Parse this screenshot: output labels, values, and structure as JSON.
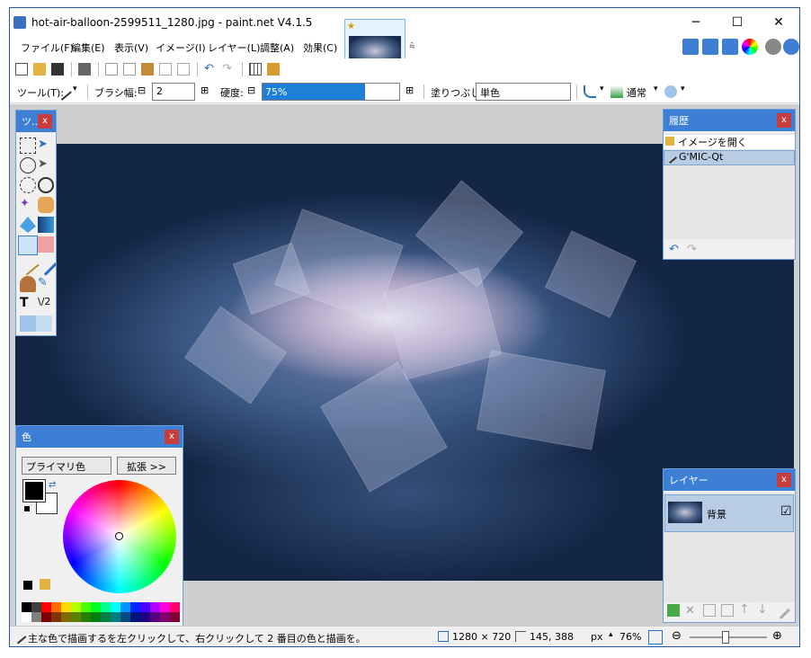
{
  "window": {
    "title": "hot-air-balloon-2599511_1280.jpg - paint.net V4.1.5",
    "minimize": "─",
    "maximize": "☐",
    "close": "✕"
  },
  "menu": [
    "ファイル(F)",
    "編集(E)",
    "表示(V)",
    "イメージ(I)",
    "レイヤー(L)",
    "調整(A)",
    "効果(C)"
  ],
  "doc_tab": {
    "star": "★"
  },
  "menu_overflow": "⩯",
  "toolbar2": {
    "tool_label": "ツール(T):",
    "brush_width_label": "ブラシ幅:",
    "brush_width_value": "2",
    "hardness_label": "硬度:",
    "hardness_value": "75%",
    "hardness_fraction": 0.75,
    "fill_label": "塗りつぶし:",
    "fill_value": "単色",
    "blend_value": "通常",
    "minus": "⊟",
    "plus": "⊞"
  },
  "tools_panel": {
    "title": "ツ..",
    "close": "x"
  },
  "history": {
    "title": "履歴",
    "close": "x",
    "items": [
      "イメージを開く",
      "G'MIC-Qt"
    ],
    "selected": 1
  },
  "layers": {
    "title": "レイヤー",
    "close": "x",
    "items": [
      {
        "name": "背景",
        "visible": "☑"
      }
    ]
  },
  "color": {
    "title": "色",
    "close": "x",
    "primary_select": "プライマリ色",
    "expand_button": "拡張 >>"
  },
  "palette": [
    "#000000",
    "#404040",
    "#ff0000",
    "#ff6a00",
    "#ffd800",
    "#b6ff00",
    "#4cff00",
    "#00ff21",
    "#00ff90",
    "#00ffff",
    "#0094ff",
    "#0026ff",
    "#4800ff",
    "#b200ff",
    "#ff00dc",
    "#ff006e",
    "#ffffff",
    "#808080",
    "#7f0000",
    "#7f3300",
    "#7f6a00",
    "#5b7f00",
    "#267f00",
    "#007f0e",
    "#007f46",
    "#007f7f",
    "#004a7f",
    "#00137f",
    "#21007f",
    "#57007f",
    "#7f006e",
    "#7f0037"
  ],
  "status": {
    "hint": "主な色で描画するを左クリックして、右クリックして 2 番目の色と描画を。",
    "size": "1280 × 720",
    "coords": "145, 388",
    "unit": "px",
    "zoom": "76%"
  },
  "accent": "#3c7fd4"
}
